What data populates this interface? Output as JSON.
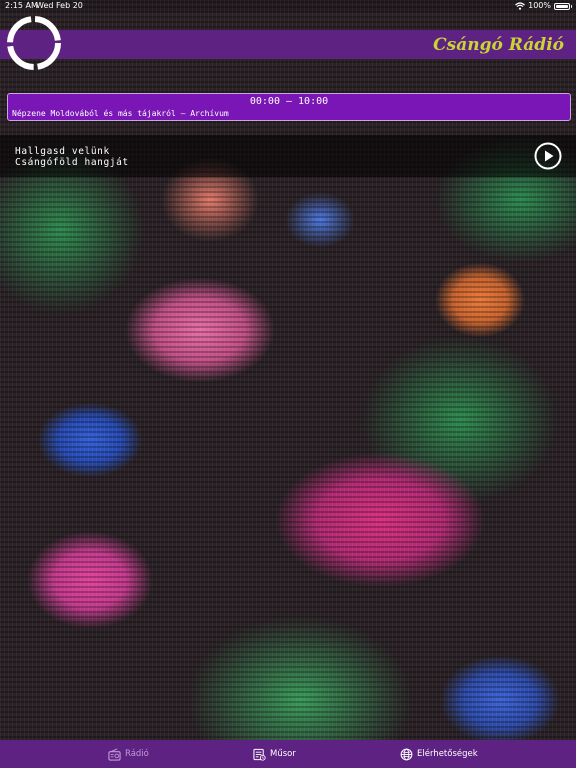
{
  "status_bar": {
    "time": "2:15 AM",
    "date": "Wed Feb 20",
    "battery_text": "100%"
  },
  "header": {
    "app_title": "Csángó Rádió",
    "accent_color": "#c8d534",
    "bar_color": "#5e2282"
  },
  "program": {
    "time_range": "00:00 – 10:00",
    "title": "Népzene Moldovából és más tájakról – Archívum"
  },
  "player": {
    "line1": "Hallgasd velünk",
    "line2": "Csángóföld hangját",
    "play_icon": "play-circle-icon"
  },
  "tabs": [
    {
      "label": "Rádió",
      "icon": "radio-icon",
      "active": true
    },
    {
      "label": "Műsor",
      "icon": "schedule-icon",
      "active": false
    },
    {
      "label": "Elérhetőségek",
      "icon": "globe-icon",
      "active": false
    }
  ]
}
